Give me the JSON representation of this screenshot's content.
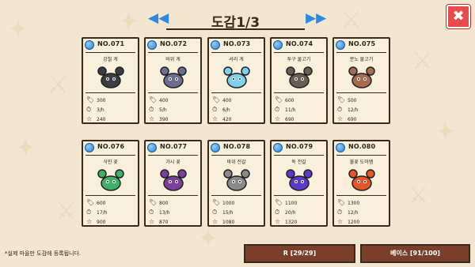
{
  "pager": {
    "title": "도감1/3",
    "prev_icon": "double-left-arrow-icon",
    "next_icon": "double-right-arrow-icon"
  },
  "close_icon": "close-x-icon",
  "cards": [
    {
      "no": "NO.071",
      "name": "강철 게",
      "s1": "300",
      "s2": "3/h",
      "s3": "240",
      "color": "#3c3c44"
    },
    {
      "no": "NO.072",
      "name": "바위 게",
      "s1": "400",
      "s2": "5/h",
      "s3": "390",
      "color": "#6b6e8f"
    },
    {
      "no": "NO.073",
      "name": "서리 게",
      "s1": "400",
      "s2": "6/h",
      "s3": "420",
      "color": "#7fd0ef"
    },
    {
      "no": "NO.074",
      "name": "투구 물고기",
      "s1": "600",
      "s2": "11/h",
      "s3": "690",
      "color": "#6a5f55"
    },
    {
      "no": "NO.075",
      "name": "분노 물고기",
      "s1": "500",
      "s2": "12/h",
      "s3": "690",
      "color": "#a86b4e"
    },
    {
      "no": "NO.076",
      "name": "식인 꽃",
      "s1": "600",
      "s2": "17/h",
      "s3": "900",
      "color": "#3fb06a"
    },
    {
      "no": "NO.077",
      "name": "가시 꽃",
      "s1": "800",
      "s2": "13/h",
      "s3": "870",
      "color": "#7a3f9b"
    },
    {
      "no": "NO.078",
      "name": "바위 전갈",
      "s1": "1000",
      "s2": "15/h",
      "s3": "1080",
      "color": "#8a8a8a"
    },
    {
      "no": "NO.079",
      "name": "독 전갈",
      "s1": "1100",
      "s2": "20/h",
      "s3": "1320",
      "color": "#5a3ac7"
    },
    {
      "no": "NO.080",
      "name": "불꽃 도마뱀",
      "s1": "1300",
      "s2": "12/h",
      "s3": "1200",
      "color": "#e5572a"
    }
  ],
  "stat_icons": [
    "tag-icon",
    "clock-icon",
    "star-icon"
  ],
  "footer": {
    "note": "*실제 마을만 도감에 등록됩니다.",
    "btn_r": "R [29/29]",
    "btn_base": "베이스 [91/100]"
  }
}
